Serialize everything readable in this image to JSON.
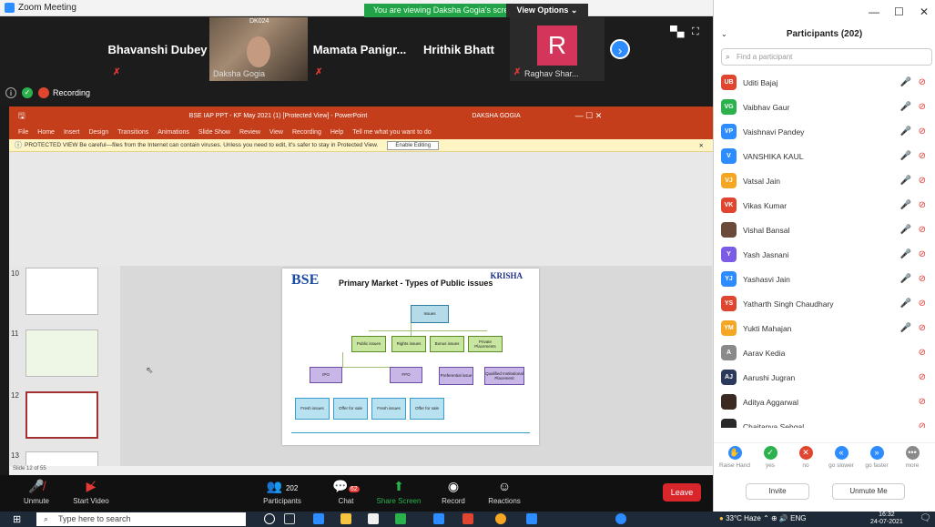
{
  "window": {
    "title": "Zoom Meeting"
  },
  "share_banner": {
    "viewing": "You are viewing Daksha Gogia's screen",
    "view_options": "View Options ⌄"
  },
  "video_strip": {
    "tiles": [
      {
        "name": "Bhavanshi Dubey"
      },
      {
        "name": "Daksha Gogia",
        "camera_label": "DK024"
      },
      {
        "name": "Mamata Panigr..."
      },
      {
        "name": "Hrithik Bhatt"
      },
      {
        "name": "Raghav Shar...",
        "initial": "R"
      }
    ]
  },
  "status": {
    "recording": "Recording"
  },
  "powerpoint": {
    "title": "BSE IAP PPT - KF May 2021 (1) [Protected View] - PowerPoint",
    "user": "DAKSHA GOGIA",
    "ribbon_tabs": [
      "File",
      "Home",
      "Insert",
      "Design",
      "Transitions",
      "Animations",
      "Slide Show",
      "Review",
      "View",
      "Recording",
      "Help",
      "Tell me what you want to do"
    ],
    "protected_view": "PROTECTED VIEW  Be careful—files from the Internet can contain viruses. Unless you need to edit, it's safer to stay in Protected View.",
    "enable_editing": "Enable Editing",
    "thumbnails": [
      "10",
      "11",
      "12",
      "13"
    ],
    "status": "Slide 12 of 55",
    "slide": {
      "logo": "BSE",
      "title": "Primary Market - Types of Public issues",
      "brand": "KRISHA",
      "root": "Issues",
      "level1": [
        "Public issues",
        "Rights issues",
        "Bonus issues",
        "Private Placements"
      ],
      "level2": [
        "IPO",
        "FPO",
        "Preferential issue",
        "Qualified Institutional Placement"
      ],
      "level3": [
        "Fresh issues",
        "Offer for sale",
        "Fresh issues",
        "Offer for sale"
      ]
    }
  },
  "controls": {
    "unmute": "Unmute",
    "start_video": "Start Video",
    "participants": "Participants",
    "participants_count": "202",
    "chat": "Chat",
    "chat_badge": "62",
    "share_screen": "Share Screen",
    "record": "Record",
    "reactions": "Reactions",
    "leave": "Leave"
  },
  "panel": {
    "title": "Participants (202)",
    "search_placeholder": "Find a participant",
    "participants": [
      {
        "initials": "UB",
        "name": "Uditi Bajaj",
        "color": "#e0452f",
        "muted": true
      },
      {
        "initials": "VG",
        "name": "Vaibhav Gaur",
        "color": "#2bb24c",
        "muted": true
      },
      {
        "initials": "VP",
        "name": "Vaishnavi Pandey",
        "color": "#2d8cff",
        "muted": true
      },
      {
        "initials": "V",
        "name": "VANSHIKA KAUL",
        "color": "#2d8cff",
        "muted": true
      },
      {
        "initials": "VJ",
        "name": "Vatsal Jain",
        "color": "#f5a623",
        "muted": true
      },
      {
        "initials": "VK",
        "name": "Vikas Kumar",
        "color": "#e0452f",
        "muted": true
      },
      {
        "initials": "",
        "name": "Vishal Bansal",
        "color": "#6b4a3a",
        "muted": true
      },
      {
        "initials": "Y",
        "name": "Yash Jasnani",
        "color": "#7b5ce6",
        "muted": true
      },
      {
        "initials": "YJ",
        "name": "Yashasvi Jain",
        "color": "#2d8cff",
        "muted": true
      },
      {
        "initials": "YS",
        "name": "Yatharth Singh Chaudhary",
        "color": "#e0452f",
        "muted": true
      },
      {
        "initials": "YM",
        "name": "Yukti Mahajan",
        "color": "#f5a623",
        "muted": true
      },
      {
        "initials": "A",
        "name": "Aarav Kedia",
        "color": "#8a8a8a",
        "muted": false
      },
      {
        "initials": "AJ",
        "name": "Aarushi Jugran",
        "color": "#2b3a5c",
        "muted": false
      },
      {
        "initials": "",
        "name": "Aditya Aggarwal",
        "color": "#3a2a22",
        "muted": false
      },
      {
        "initials": "",
        "name": "Chaitanya Sehgal",
        "color": "#2a2a2a",
        "muted": false
      }
    ],
    "reactions": [
      {
        "label": "Raise Hand",
        "glyph": "✋",
        "color": "#2d8cff"
      },
      {
        "label": "yes",
        "glyph": "✓",
        "color": "#2bb24c"
      },
      {
        "label": "no",
        "glyph": "✕",
        "color": "#e0452f"
      },
      {
        "label": "go slower",
        "glyph": "«",
        "color": "#2d8cff"
      },
      {
        "label": "go faster",
        "glyph": "»",
        "color": "#2d8cff"
      },
      {
        "label": "more",
        "glyph": "•••",
        "color": "#8a8a8a"
      }
    ],
    "invite": "Invite",
    "unmute_me": "Unmute Me"
  },
  "taskbar": {
    "search_placeholder": "Type here to search",
    "weather": "33°C Haze",
    "lang": "ENG",
    "time": "16:32",
    "date": "24-07-2021"
  }
}
